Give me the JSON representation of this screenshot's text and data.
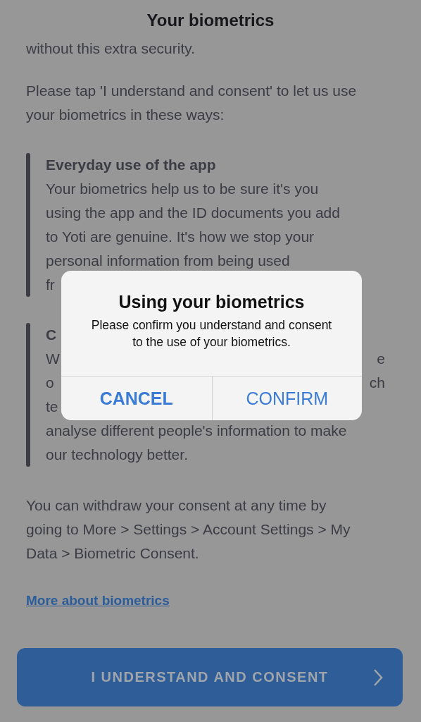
{
  "header": {
    "title": "Your biometrics"
  },
  "intro_fragment": "without this extra security.",
  "intro": "Please tap 'I understand and consent' to let us use your biometrics in these ways:",
  "sections": [
    {
      "heading": "Everyday use of the app",
      "lines": [
        {
          "left": "Your biometrics help us to be sure it's you"
        },
        {
          "left": "using the app and the ID documents you add"
        },
        {
          "left": "to Yoti are genuine. It's how we stop your"
        },
        {
          "left": "personal information from being used"
        },
        {
          "left": "fr"
        }
      ]
    },
    {
      "heading": "C",
      "lines": [
        {
          "left": "W",
          "right": "e"
        },
        {
          "left": "o",
          "right": "ch"
        },
        {
          "left": "te"
        },
        {
          "left": "analyse different people's information to make"
        },
        {
          "left": "our technology better."
        }
      ]
    }
  ],
  "withdraw": "You can withdraw your consent at any time by going to More > Settings > Account Settings > My Data > Biometric Consent.",
  "link": "More about biometrics",
  "primary_button": {
    "label": "I UNDERSTAND AND CONSENT"
  },
  "alert": {
    "title": "Using your biometrics",
    "message": "Please confirm you understand and consent to the use of your biometrics.",
    "buttons": [
      {
        "label": "CANCEL",
        "kind": "cancel"
      },
      {
        "label": "CONFIRM",
        "kind": "default"
      }
    ]
  }
}
